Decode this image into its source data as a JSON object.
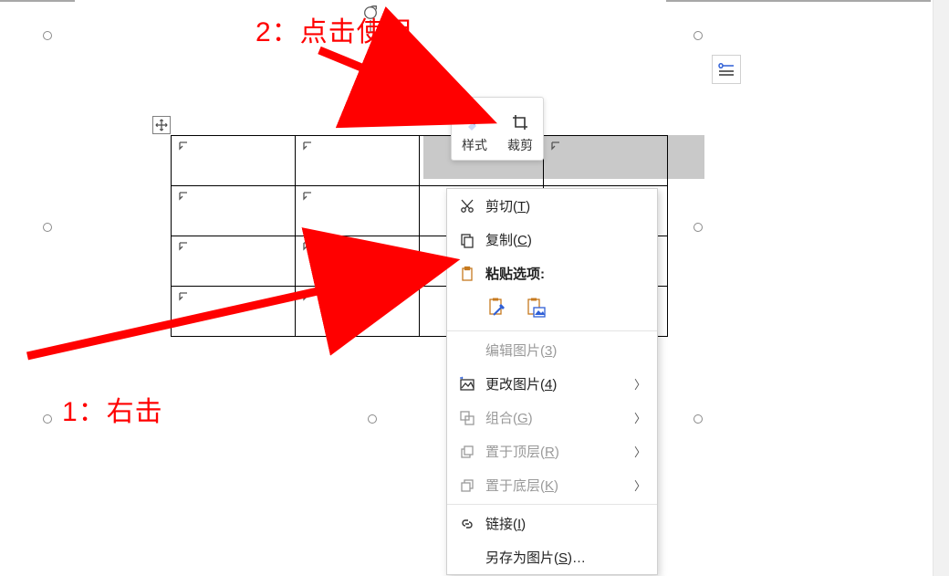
{
  "annotations": {
    "step2": "2：点击使用",
    "step1": "1：右击"
  },
  "mini_toolbar": {
    "style_label": "样式",
    "crop_label": "裁剪"
  },
  "context_menu": {
    "cut": {
      "label": "剪切(",
      "accel": "T",
      "tail": ")"
    },
    "copy": {
      "label": "复制(",
      "accel": "C",
      "tail": ")"
    },
    "paste_options_label": "粘贴选项:",
    "edit_picture": {
      "label": "编辑图片(",
      "accel": "3",
      "tail": ")"
    },
    "change_picture": {
      "label": "更改图片(",
      "accel": "4",
      "tail": ")"
    },
    "group": {
      "label": "组合(",
      "accel": "G",
      "tail": ")"
    },
    "bring_front": {
      "label": "置于顶层(",
      "accel": "R",
      "tail": ")"
    },
    "send_back": {
      "label": "置于底层(",
      "accel": "K",
      "tail": ")"
    },
    "link": {
      "label": "链接(",
      "accel": "I",
      "tail": ")"
    },
    "save_as_picture": {
      "label": "另存为图片(",
      "accel": "S",
      "tail": ")…"
    }
  },
  "icons": {
    "rotate": "rotate-icon",
    "layout_options": "layout-options-icon",
    "move_handle": "move-handle-icon",
    "style": "brush-icon",
    "crop": "crop-icon",
    "cut": "scissors-icon",
    "copy": "copy-icon",
    "paste": "clipboard-icon",
    "paste_keep_fmt": "paste-keep-format-icon",
    "paste_picture": "paste-picture-icon",
    "change_picture": "change-picture-icon",
    "group": "group-icon",
    "bring_front": "bring-front-icon",
    "send_back": "send-back-icon",
    "link": "link-icon",
    "chevron": "chevron-right-icon"
  },
  "colors": {
    "annotation": "#ff0000",
    "accent": "#2f5fd6"
  }
}
